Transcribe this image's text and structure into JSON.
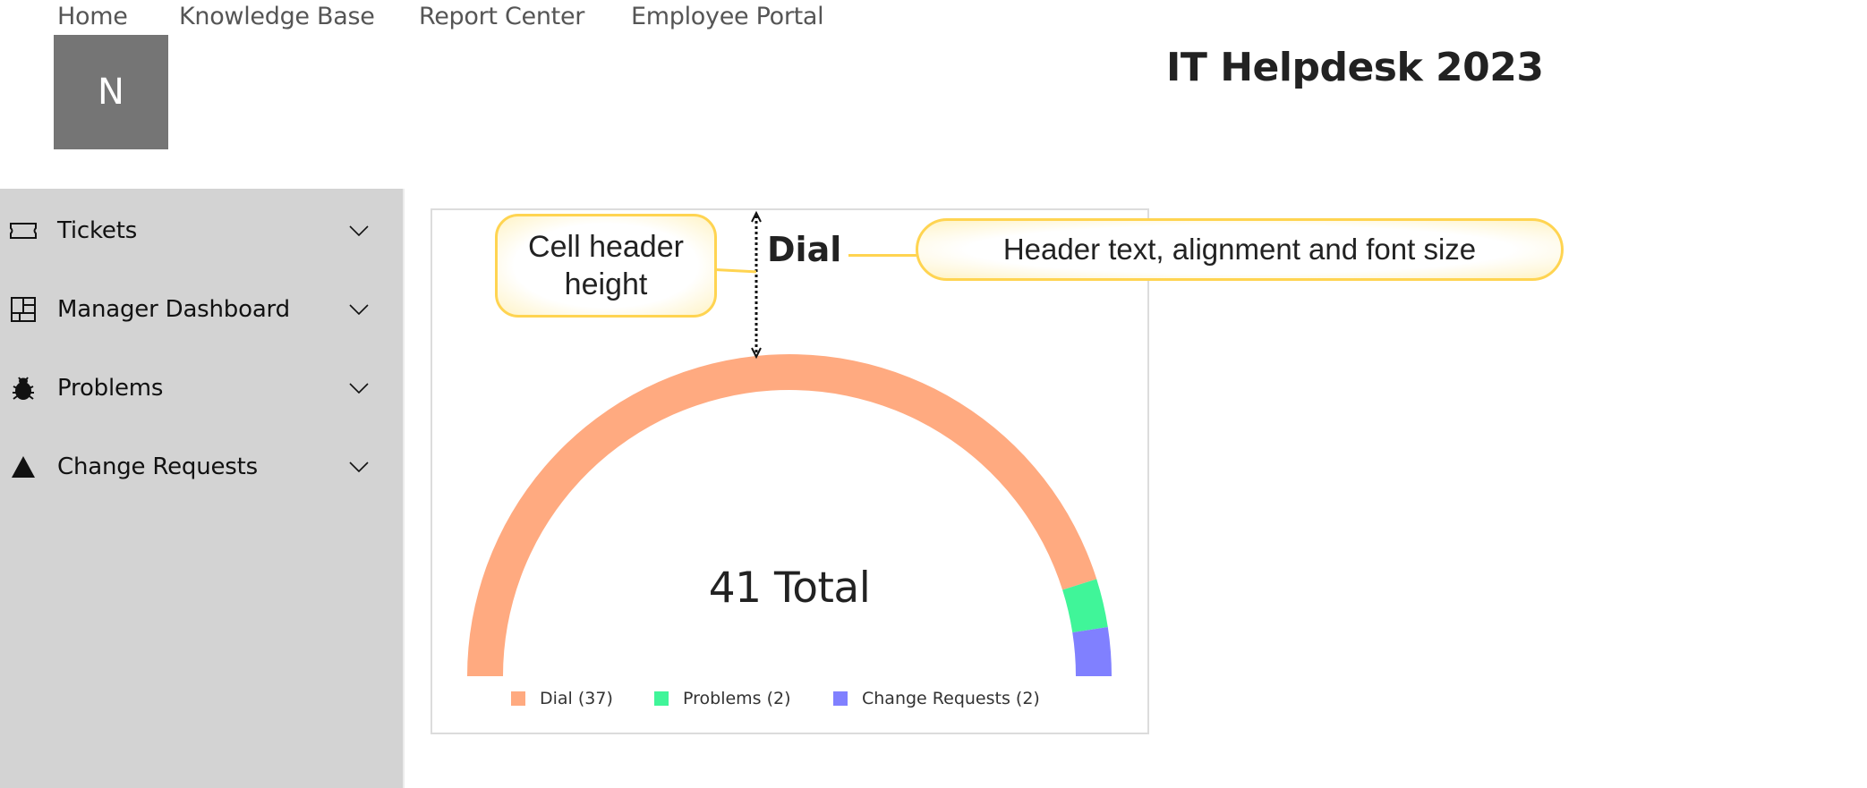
{
  "top_nav": {
    "items": [
      {
        "label": "Home"
      },
      {
        "label": "Knowledge Base"
      },
      {
        "label": "Report Center"
      },
      {
        "label": "Employee Portal"
      }
    ]
  },
  "avatar": {
    "initial": "N",
    "color": "#757575"
  },
  "app_title": "IT Helpdesk 2023",
  "sidebar": {
    "items": [
      {
        "label": "Tickets",
        "icon": "ticket-icon"
      },
      {
        "label": "Manager Dashboard",
        "icon": "dashboard-icon"
      },
      {
        "label": "Problems",
        "icon": "bug-icon"
      },
      {
        "label": "Change Requests",
        "icon": "triangle-icon"
      }
    ],
    "expand_icon": "chevron-down-icon"
  },
  "card": {
    "header": "Dial",
    "total_label": "41 Total"
  },
  "annotations": {
    "cell_header_height": "Cell header height",
    "header_text": "Header text, alignment and font size"
  },
  "chart_data": {
    "type": "pie",
    "variant": "semicircle-gauge",
    "title": "Dial",
    "center_label": "41 Total",
    "total": 41,
    "series": [
      {
        "name": "Dial",
        "value": 37,
        "color": "#ffaa80",
        "legend": "Dial (37)"
      },
      {
        "name": "Problems",
        "value": 2,
        "color": "#40f599",
        "legend": "Problems (2)"
      },
      {
        "name": "Change Requests",
        "value": 2,
        "color": "#8080ff",
        "legend": "Change Requests (2)"
      }
    ],
    "legend_position": "bottom"
  }
}
